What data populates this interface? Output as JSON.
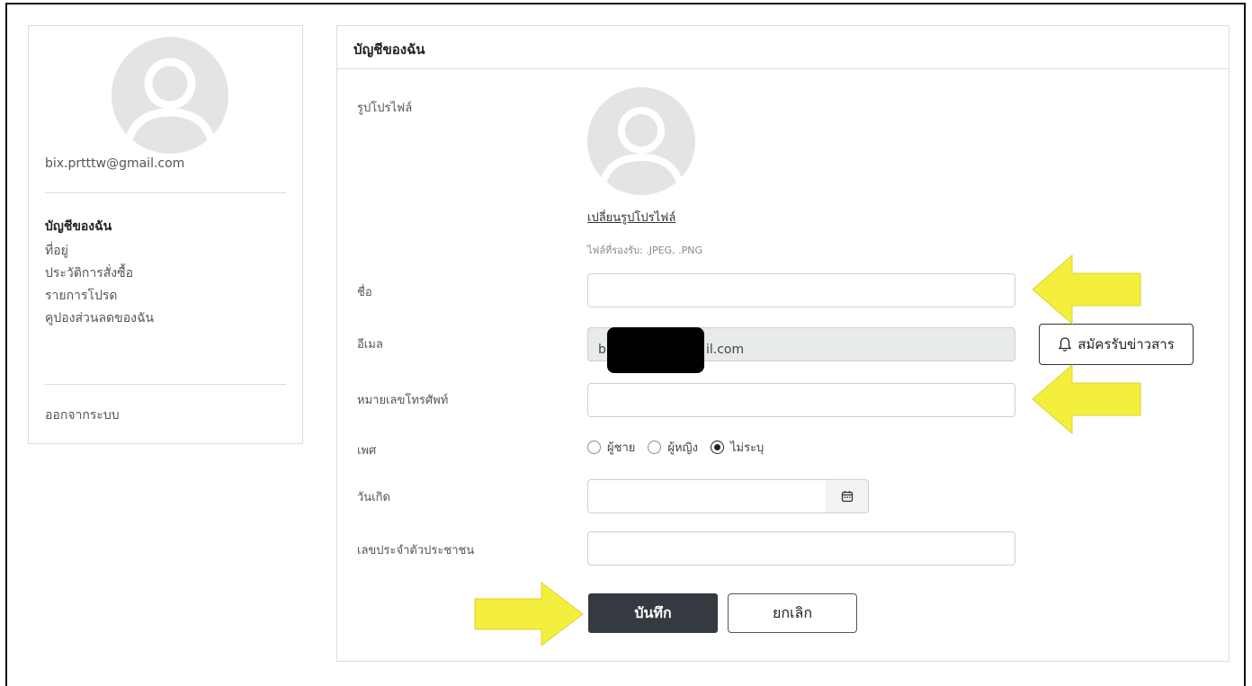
{
  "sidebar": {
    "email": "bix.prtttw@gmail.com",
    "items": [
      {
        "label": "บัญชีของฉัน",
        "active": true
      },
      {
        "label": "ที่อยู่"
      },
      {
        "label": "ประวัติการสั่งซื้อ"
      },
      {
        "label": "รายการโปรด"
      },
      {
        "label": "คูปองส่วนลดของฉัน"
      }
    ],
    "logout": "ออกจากระบบ"
  },
  "panel": {
    "title": "บัญชีของฉัน",
    "profile_label": "รูปโปรไฟล์",
    "change_photo": "เปลี่ยนรูปโปรไฟล์",
    "file_hint": "ไฟล์ที่รองรับ: .JPEG, .PNG",
    "name_label": "ชื่อ",
    "name_value": "",
    "email_label": "อีเมล",
    "email_value": "b...il.com",
    "email_visible": "il.com",
    "email_prefix": "b",
    "subscribe": "สมัครรับข่าวสาร",
    "phone_label": "หมายเลขโทรศัพท์",
    "phone_value": "",
    "gender_label": "เพศ",
    "gender_options": [
      "ผู้ชาย",
      "ผู้หญิง",
      "ไม่ระบุ"
    ],
    "gender_selected": "ไม่ระบุ",
    "birthday_label": "วันเกิด",
    "birthday_value": "",
    "id_label": "เลขประจำตัวประชาชน",
    "id_value": "",
    "save": "บันทึก",
    "cancel": "ยกเลิก"
  },
  "colors": {
    "arrow_fill": "#f4ef3c",
    "save_bg": "#343a40",
    "avatar_bg": "#e4e4e4"
  }
}
